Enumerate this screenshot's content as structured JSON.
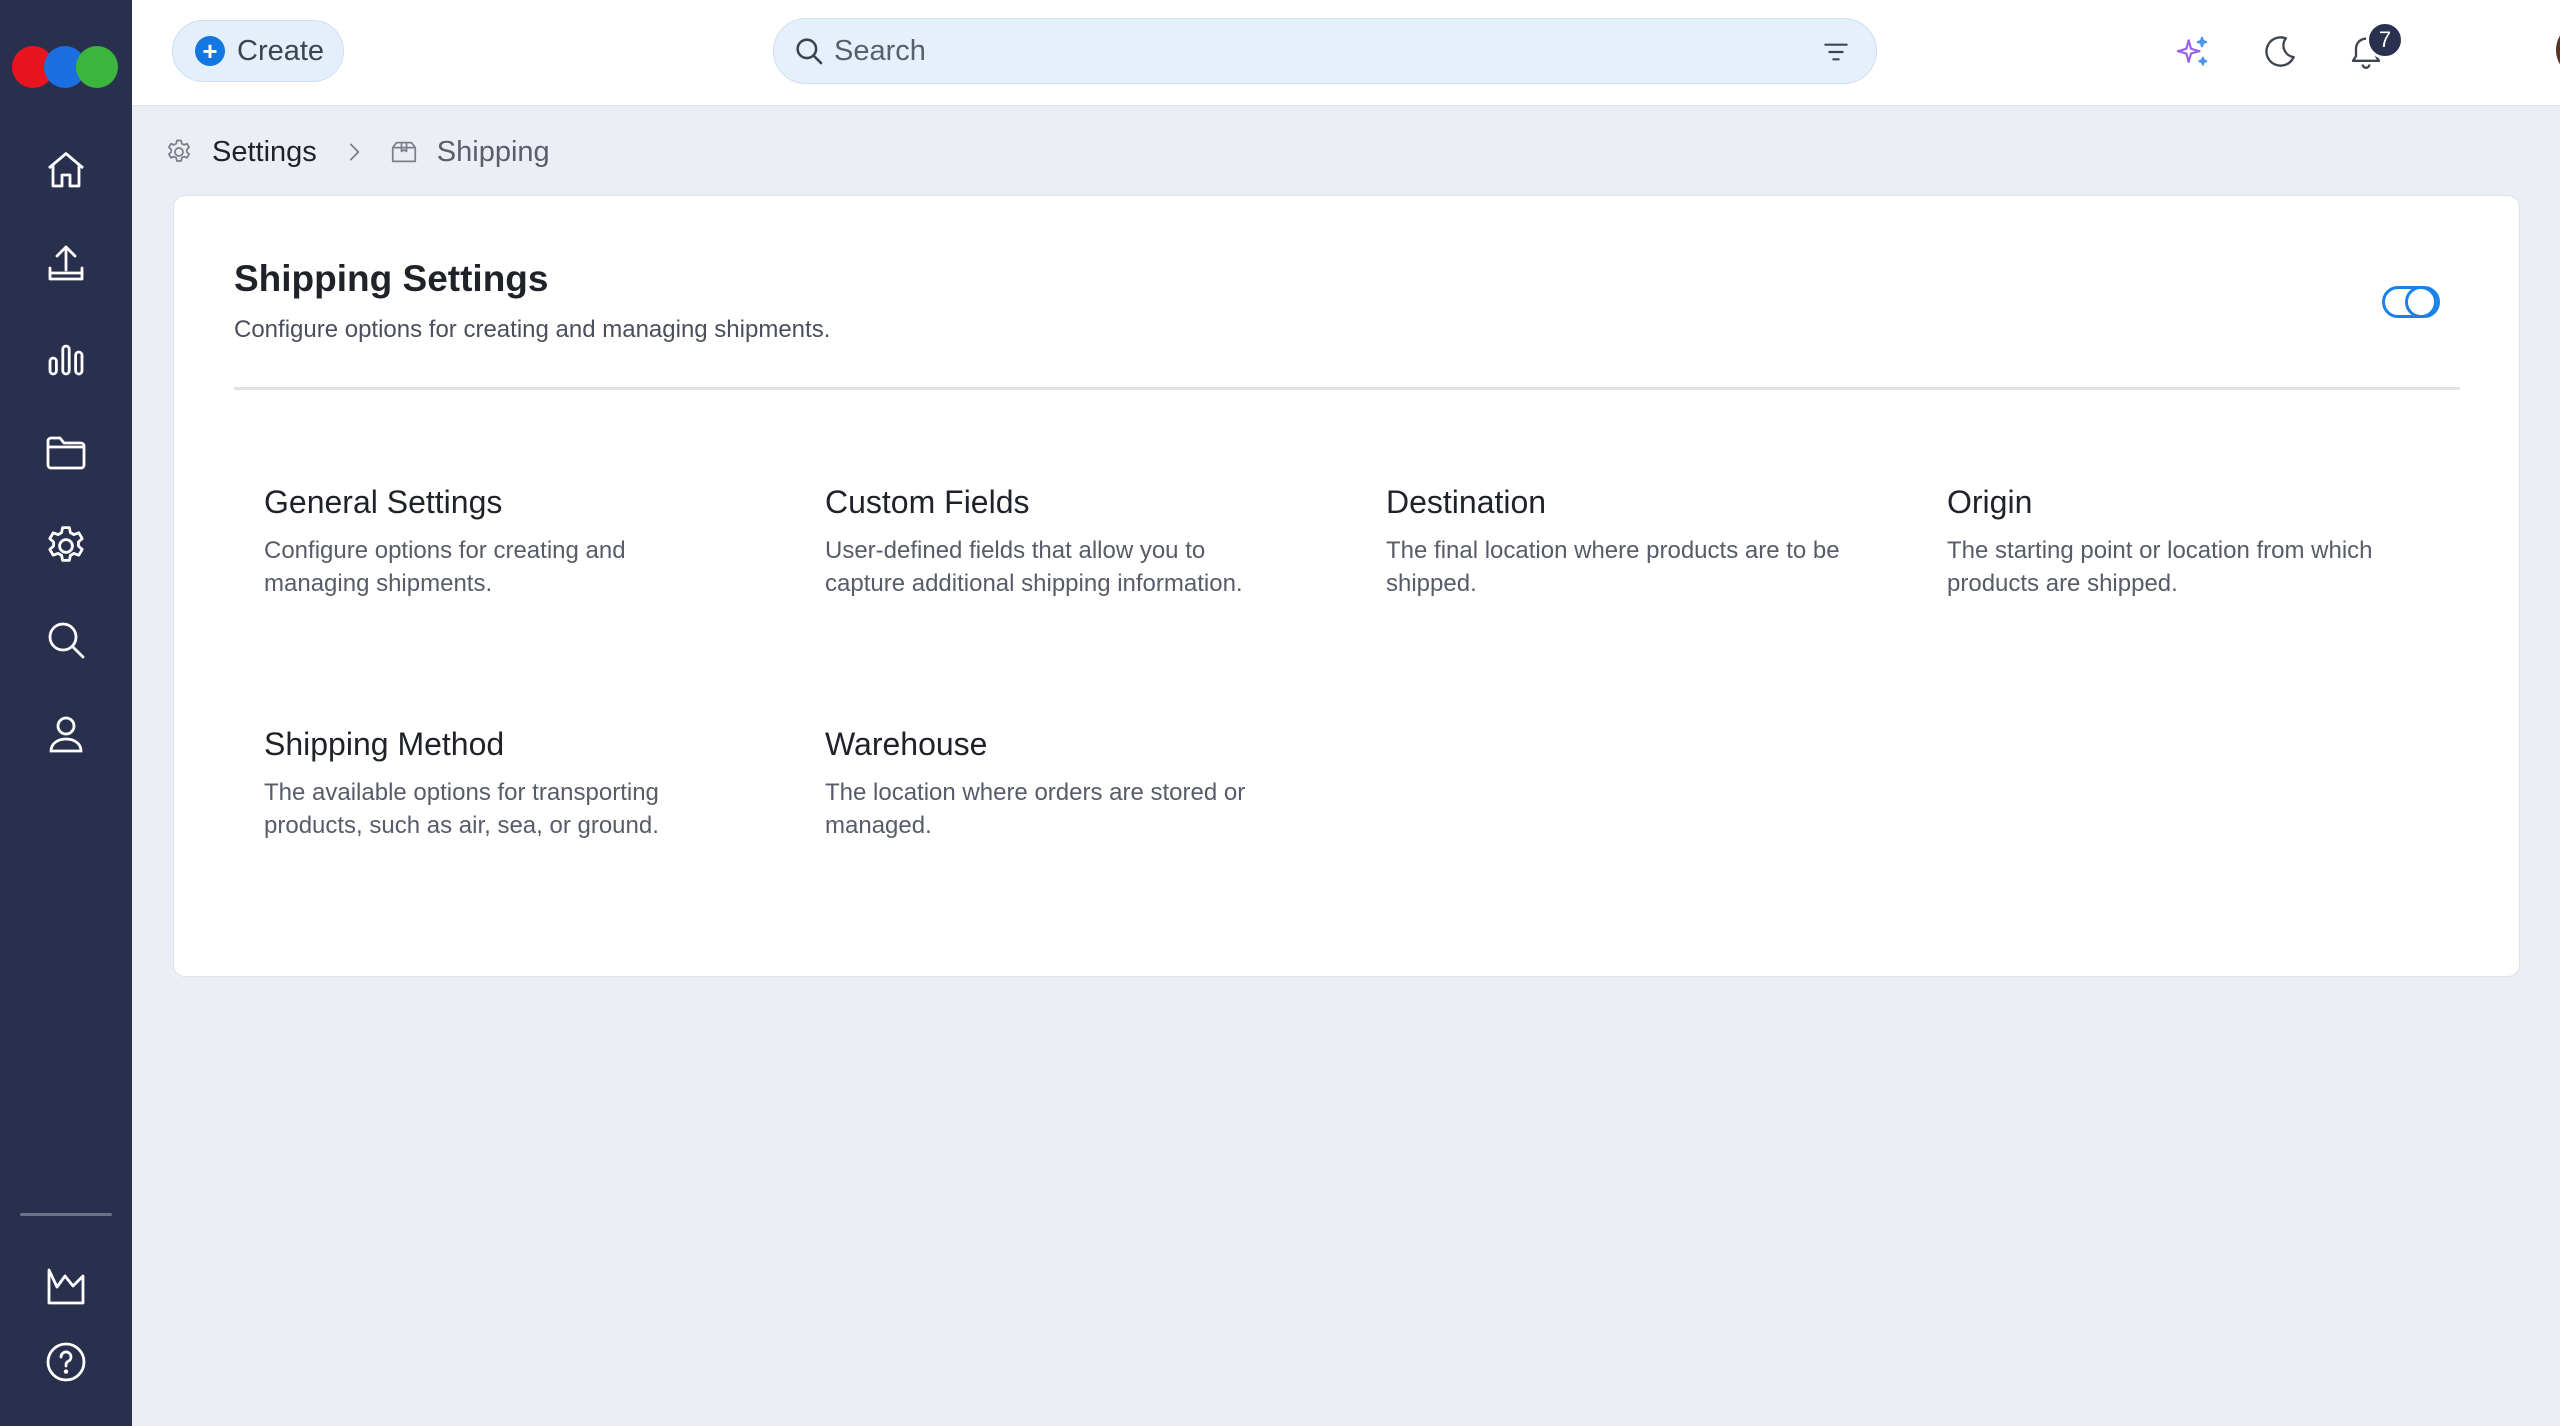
{
  "sidebar": {
    "items": [
      {
        "name": "home-icon"
      },
      {
        "name": "upload-icon"
      },
      {
        "name": "analytics-icon"
      },
      {
        "name": "folder-icon"
      },
      {
        "name": "settings-icon"
      },
      {
        "name": "search-icon"
      },
      {
        "name": "user-icon"
      }
    ],
    "bottom": [
      {
        "name": "reports-icon"
      },
      {
        "name": "help-icon"
      }
    ]
  },
  "header": {
    "create_label": "Create",
    "search_placeholder": "Search",
    "notification_count": "7"
  },
  "breadcrumb": {
    "root": "Settings",
    "current": "Shipping"
  },
  "card": {
    "title": "Shipping Settings",
    "subtitle": "Configure options for creating and managing shipments.",
    "toggle_on": true,
    "items": [
      {
        "title": "General Settings",
        "description": "Configure options for creating and managing shipments."
      },
      {
        "title": "Custom Fields",
        "description": "User-defined fields that allow you to capture additional shipping information."
      },
      {
        "title": "Destination",
        "description": "The final location where products are to be shipped."
      },
      {
        "title": "Origin",
        "description": "The starting point or location from which products are shipped."
      },
      {
        "title": "Shipping Method",
        "description": "The available options for transporting products, such as air, sea, or ground."
      },
      {
        "title": "Warehouse",
        "description": "The location where orders are stored or managed."
      }
    ]
  },
  "colors": {
    "sidebar_bg": "#29304e",
    "accent": "#1476e0",
    "page_bg": "#ebeef4",
    "logo": [
      "#e8141f",
      "#1b6fe0",
      "#3cb53c"
    ]
  }
}
